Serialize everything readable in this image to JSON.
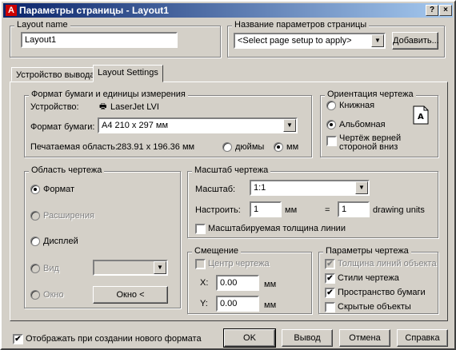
{
  "title": "Параметры страницы - Layout1",
  "title_buttons": {
    "help": "?",
    "close": "×"
  },
  "layout_name": {
    "label": "Layout name",
    "value": "Layout1"
  },
  "page_setup": {
    "label": "Название параметров страницы",
    "value": "<Select page setup to apply>",
    "add_button": "Добавить..."
  },
  "tabs": [
    {
      "label": "Устройство вывода"
    },
    {
      "label": "Layout Settings"
    }
  ],
  "paper": {
    "group": "Формат бумаги и единицы измерения",
    "device_label": "Устройство:",
    "device_value": "LaserJet LVI",
    "size_label": "Формат бумаги:",
    "size_value": "A4 210 x 297 мм",
    "printable_label": "Печатаемая область:",
    "printable_value": "283.91 x 196.36 мм",
    "units": [
      "дюймы",
      "мм"
    ],
    "units_selected": "мм"
  },
  "orientation": {
    "group": "Ориентация чертежа",
    "options": [
      "Книжная",
      "Альбомная"
    ],
    "selected": "Альбомная",
    "upside_down": "Чертёж верней стороной вниз",
    "upside_down_checked": false,
    "icon": "landscape-page-icon"
  },
  "plot_area": {
    "group": "Область чертежа",
    "options": [
      "Формат",
      "Расширения",
      "Дисплей",
      "Вид",
      "Окно"
    ],
    "selected": "Формат",
    "disabled": [
      "Расширения",
      "Вид",
      "Окно"
    ],
    "window_button": "Окно <"
  },
  "scale": {
    "group": "Масштаб чертежа",
    "scale_label": "Масштаб:",
    "scale_value": "1:1",
    "custom_label": "Настроить:",
    "custom_mm": "1",
    "mm_label": "мм",
    "equals": "=",
    "custom_units": "1",
    "units_label": "drawing units",
    "lineweights": "Масштабируемая толщина линии",
    "lineweights_checked": false
  },
  "offset": {
    "group": "Смещение",
    "center": "Центр чертежа",
    "center_checked": false,
    "x_label": "X:",
    "x_value": "0.00",
    "y_label": "Y:",
    "y_value": "0.00",
    "unit": "мм"
  },
  "plot_options": {
    "group": "Параметры чертежа",
    "items": [
      {
        "label": "Толщина линий объекта",
        "checked": true,
        "disabled": true
      },
      {
        "label": "Стили чертежа",
        "checked": true,
        "disabled": false
      },
      {
        "label": "Пространство бумаги",
        "checked": true,
        "disabled": false
      },
      {
        "label": "Скрытые объекты",
        "checked": false,
        "disabled": false
      }
    ]
  },
  "footer": {
    "show_on_new": "Отображать при создании нового формата",
    "show_on_new_checked": true,
    "ok": "OK",
    "plot": "Вывод",
    "cancel": "Отмена",
    "help": "Справка"
  }
}
